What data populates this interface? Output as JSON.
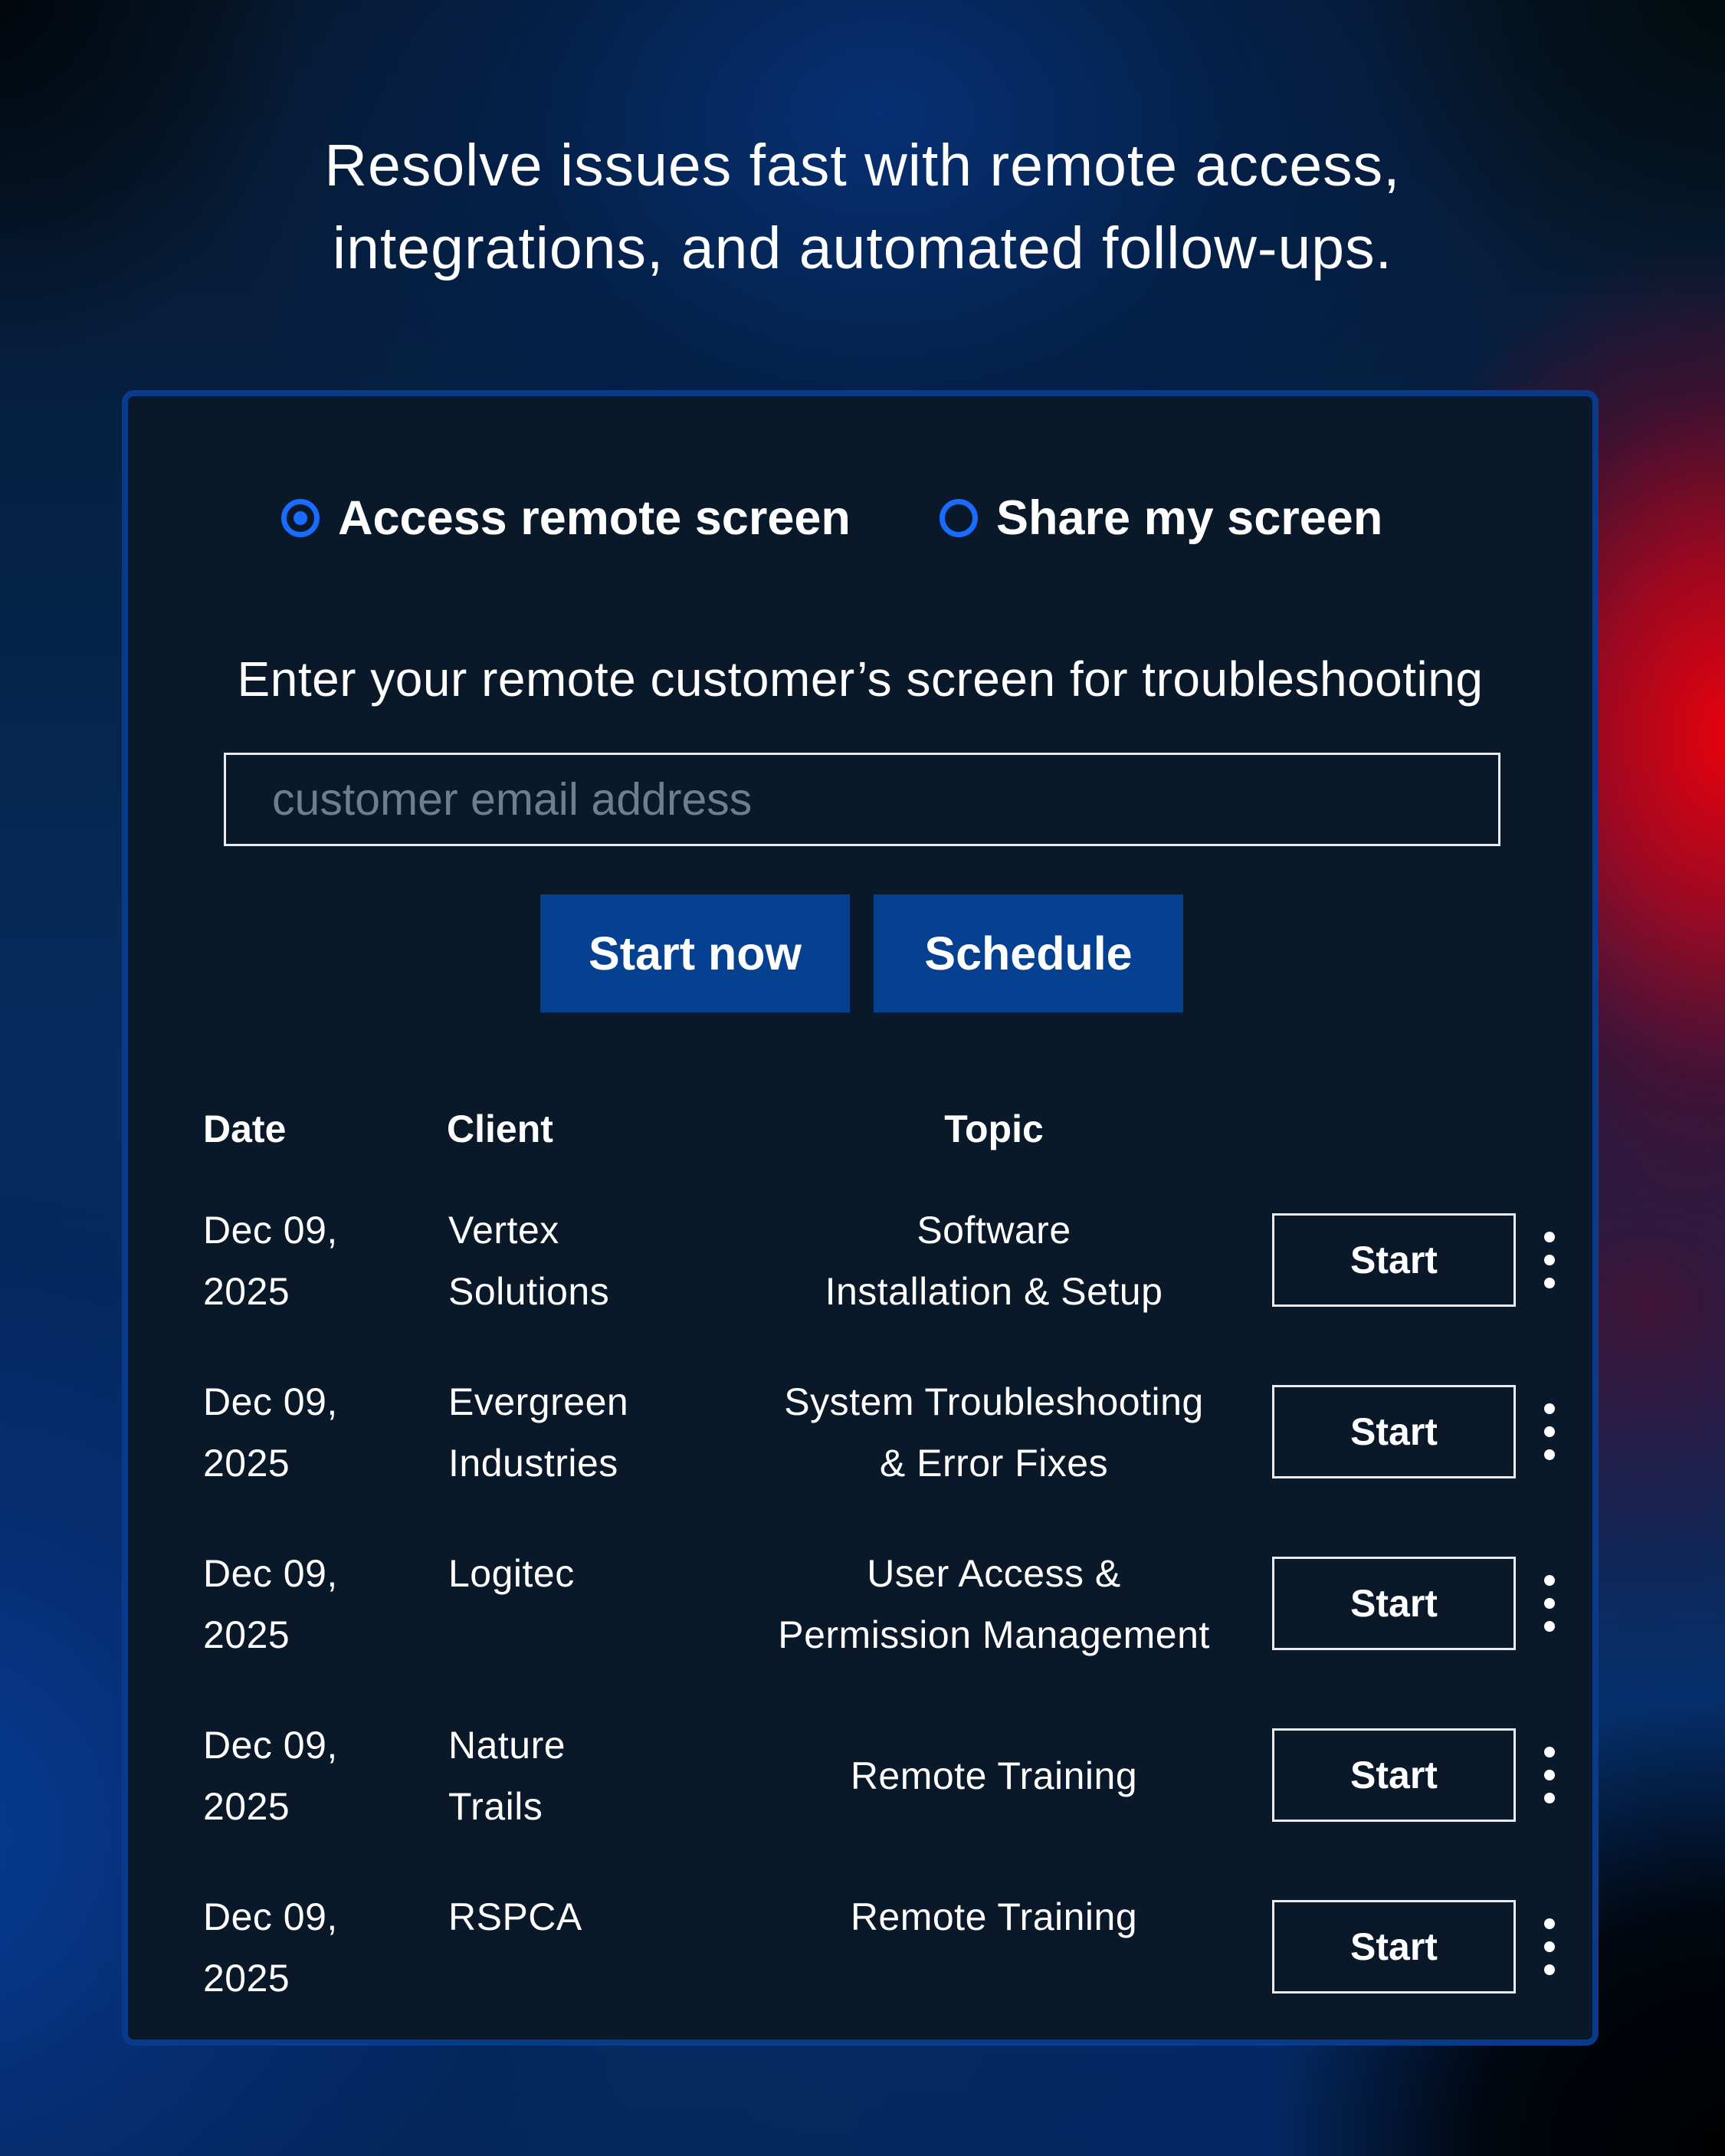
{
  "headline": {
    "line1": "Resolve issues fast with remote access,",
    "line2": "integrations, and automated follow-ups."
  },
  "mode": {
    "options": [
      {
        "label": "Access remote screen",
        "selected": true
      },
      {
        "label": "Share my screen",
        "selected": false
      }
    ]
  },
  "instruction": "Enter your remote customer’s screen for troubleshooting",
  "email": {
    "placeholder": "customer email address",
    "value": ""
  },
  "actions": {
    "start_now": "Start now",
    "schedule": "Schedule"
  },
  "table": {
    "columns": {
      "date": "Date",
      "client": "Client",
      "topic": "Topic"
    },
    "rows": [
      {
        "date": [
          "Dec 09,",
          "2025"
        ],
        "client": [
          "Vertex",
          "Solutions"
        ],
        "topic": [
          "Software",
          "Installation & Setup"
        ],
        "action": "Start"
      },
      {
        "date": [
          "Dec 09,",
          "2025"
        ],
        "client": [
          "Evergreen",
          "Industries"
        ],
        "topic": [
          "System Troubleshooting",
          "& Error Fixes"
        ],
        "action": "Start"
      },
      {
        "date": [
          "Dec 09,",
          "2025"
        ],
        "client": [
          "Logitec",
          ""
        ],
        "topic": [
          "User Access &",
          "Permission Management"
        ],
        "action": "Start"
      },
      {
        "date": [
          "Dec 09,",
          "2025"
        ],
        "client": [
          "Nature",
          "Trails"
        ],
        "topic": [
          "Remote Training",
          ""
        ],
        "action": "Start"
      },
      {
        "date": [
          "Dec 09,",
          "2025"
        ],
        "client": [
          "RSPCA",
          ""
        ],
        "topic": [
          "Remote Training",
          ""
        ],
        "action": "Start"
      }
    ]
  },
  "colors": {
    "accent_radio": "#1a6bff",
    "button_primary": "#064191",
    "panel_bg": "#0a1929",
    "panel_border": "#0a3a8c"
  }
}
